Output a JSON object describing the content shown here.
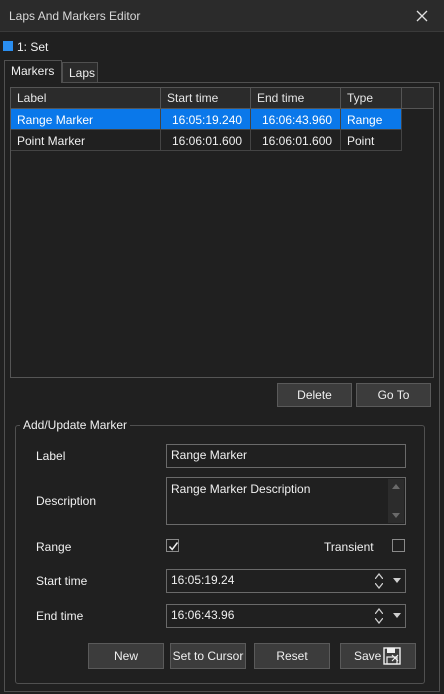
{
  "window": {
    "title": "Laps And Markers Editor"
  },
  "set": {
    "label": "1: Set",
    "color": "#2a8ef0"
  },
  "tabs": [
    {
      "label": "Markers",
      "active": true
    },
    {
      "label": "Laps",
      "active": false
    }
  ],
  "grid": {
    "columns": [
      "Label",
      "Start time",
      "End time",
      "Type"
    ],
    "rows": [
      {
        "label": "Range Marker",
        "start": "16:05:19.240",
        "end": "16:06:43.960",
        "type": "Range",
        "selected": true
      },
      {
        "label": "Point Marker",
        "start": "16:06:01.600",
        "end": "16:06:01.600",
        "type": "Point",
        "selected": false
      }
    ]
  },
  "actions": {
    "delete_label": "Delete",
    "goto_label": "Go To"
  },
  "form": {
    "group_title": "Add/Update Marker",
    "label_label": "Label",
    "label_value": "Range Marker",
    "description_label": "Description",
    "description_value": "Range Marker Description",
    "range_label": "Range",
    "range_checked": true,
    "transient_label": "Transient",
    "transient_checked": false,
    "start_label": "Start time",
    "start_value": "16:05:19.24",
    "end_label": "End time",
    "end_value": "16:06:43.96"
  },
  "buttons": {
    "new": "New",
    "set_to_cursor": "Set to Cursor",
    "reset": "Reset",
    "save": "Save"
  },
  "colors": {
    "accent": "#0a78ea",
    "background": "#202020"
  }
}
